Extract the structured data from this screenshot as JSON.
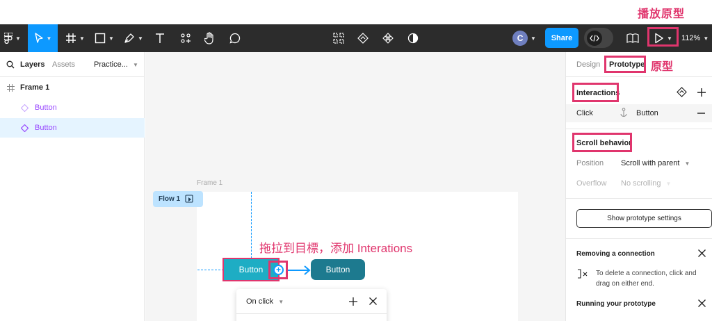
{
  "annotations": {
    "play_prototype": "播放原型",
    "prototype_tab": "原型",
    "drag_hint": "拖拉到目標，添加 Interations"
  },
  "toolbar": {
    "share_label": "Share",
    "avatar_initial": "C",
    "zoom": "112%"
  },
  "left_panel": {
    "tabs": [
      "Layers",
      "Assets"
    ],
    "page_name": "Practice...",
    "layers": [
      {
        "label": "Frame 1",
        "kind": "frame"
      },
      {
        "label": "Button",
        "kind": "component"
      },
      {
        "label": "Button",
        "kind": "component",
        "selected": true
      }
    ]
  },
  "canvas": {
    "frame_label": "Frame 1",
    "flow_label": "Flow 1",
    "button_source": "Button",
    "button_target": "Button",
    "popup": {
      "trigger": "On click"
    }
  },
  "right_panel": {
    "tabs": {
      "design": "Design",
      "prototype": "Prototype"
    },
    "interactions": {
      "title": "Interactions",
      "trigger": "Click",
      "target": "Button"
    },
    "scroll": {
      "title": "Scroll behavior",
      "position_label": "Position",
      "position_value": "Scroll with parent",
      "overflow_label": "Overflow",
      "overflow_value": "No scrolling"
    },
    "show_settings": "Show prototype settings",
    "removing": {
      "title": "Removing a connection",
      "body": "To delete a connection, click and drag on either end."
    },
    "running": {
      "title": "Running your prototype"
    }
  },
  "colors": {
    "toolbar_bg": "#2c2c2c",
    "accent_blue": "#0d99ff",
    "annotation_pink": "#e0356d",
    "component_purple": "#9747ff",
    "button_teal": "#1eadc4",
    "button_dark_teal": "#1d7a8f"
  }
}
